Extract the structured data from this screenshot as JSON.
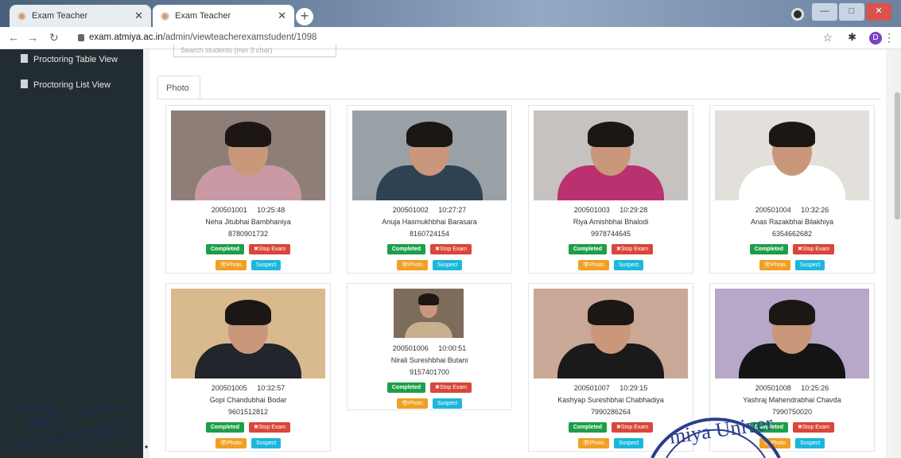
{
  "browser": {
    "tabs": [
      {
        "title": "Exam Teacher",
        "active": false
      },
      {
        "title": "Exam Teacher",
        "active": true
      }
    ],
    "new_tab": "+",
    "url_host": "exam.atmiya.ac.in",
    "url_path": "/admin/viewteacherexamstudent/1098",
    "profile_initial": "D"
  },
  "sidebar": {
    "items": [
      {
        "label": "Proctoring Table View",
        "icon": "document-icon"
      },
      {
        "label": "Proctoring List View",
        "icon": "document-icon"
      }
    ]
  },
  "main": {
    "search_placeholder": "Search students (min 3 char)",
    "tab_label": "Photo"
  },
  "buttons": {
    "completed": "Completed",
    "stop_exam": "✖Stop Exam",
    "photo": "👁Photo",
    "suspect": "Suspect"
  },
  "students": [
    {
      "id": "200501001",
      "time": "10:25:48",
      "name": "Neha Jitubhai Bambhaniya",
      "phone": "8780901732",
      "photo_colors": {
        "bg": "#8d7f78",
        "shirt": "#c99aa6"
      }
    },
    {
      "id": "200501002",
      "time": "10:27:27",
      "name": "Anuja Hasmukhbhai Barasara",
      "phone": "8160724154",
      "photo_colors": {
        "bg": "#9aa1a6",
        "shirt": "#2f4251"
      }
    },
    {
      "id": "200501003",
      "time": "10:29:28",
      "name": "Riya Amishbhai Bhalodi",
      "phone": "9978744645",
      "photo_colors": {
        "bg": "#c6c2c0",
        "shirt": "#b9316f"
      }
    },
    {
      "id": "200501004",
      "time": "10:32:26",
      "name": "Anas Razakbhai Bilakhiya",
      "phone": "6354662682",
      "photo_colors": {
        "bg": "#e3e0dc",
        "shirt": "#ffffff"
      }
    },
    {
      "id": "200501005",
      "time": "10:32:57",
      "name": "Gopi Chandubhai Bodar",
      "phone": "9601512812",
      "photo_colors": {
        "bg": "#d9b98e",
        "shirt": "#22252b"
      }
    },
    {
      "id": "200501006",
      "time": "10:00:51",
      "name": "Nirali Sureshbhai Butani",
      "phone": "9157401700",
      "photo_colors": {
        "bg": "#7d6c5b",
        "shirt": "#c8b08f"
      }
    },
    {
      "id": "200501007",
      "time": "10:29:15",
      "name": "Kashyap Sureshbhai Chabhadiya",
      "phone": "7990286264",
      "photo_colors": {
        "bg": "#c9a897",
        "shirt": "#1a1a1a"
      }
    },
    {
      "id": "200501008",
      "time": "10:25:26",
      "name": "Yashraj Mahendrabhai Chavda",
      "phone": "7990750020",
      "photo_colors": {
        "bg": "#b7a7c9",
        "shirt": "#141414"
      }
    }
  ],
  "overlay": {
    "stamp_text": "miya Univer"
  }
}
